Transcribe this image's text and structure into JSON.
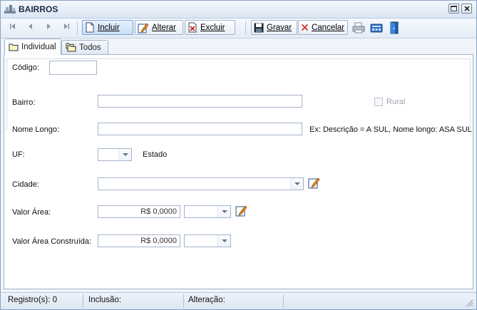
{
  "window": {
    "title": "BAIRROS"
  },
  "toolbar": {
    "incluir_label": "Incluir",
    "alterar_label": "Alterar",
    "excluir_label": "Excluir",
    "gravar_label": "Gravar",
    "cancelar_label": "Cancelar"
  },
  "tabs": [
    {
      "label": "Individual"
    },
    {
      "label": "Todos"
    }
  ],
  "form": {
    "codigo": {
      "label": "Código:",
      "value": ""
    },
    "bairro": {
      "label": "Bairro:",
      "value": ""
    },
    "rural": {
      "label": "Rural",
      "checked": false
    },
    "nome_longo": {
      "label": "Nome Longo:",
      "value": "",
      "hint": "Ex: Descrição = A SUL, Nome longo: ASA SUL"
    },
    "uf": {
      "label": "UF:",
      "value": "",
      "estado_label": "Estado"
    },
    "cidade": {
      "label": "Cidade:",
      "value": ""
    },
    "valor_area": {
      "label": "Valor Área:",
      "value": "R$ 0,0000",
      "unit": ""
    },
    "valor_area_construida": {
      "label": "Valor Área Construída:",
      "value": "R$ 0,0000",
      "unit": ""
    }
  },
  "status": {
    "registros": "Registro(s): 0",
    "inclusao": "Inclusão:",
    "alteracao": "Alteração:"
  },
  "colors": {
    "accent": "#2b64b3",
    "window_bg": "#f0f4fa",
    "border": "#9fb2cc"
  }
}
